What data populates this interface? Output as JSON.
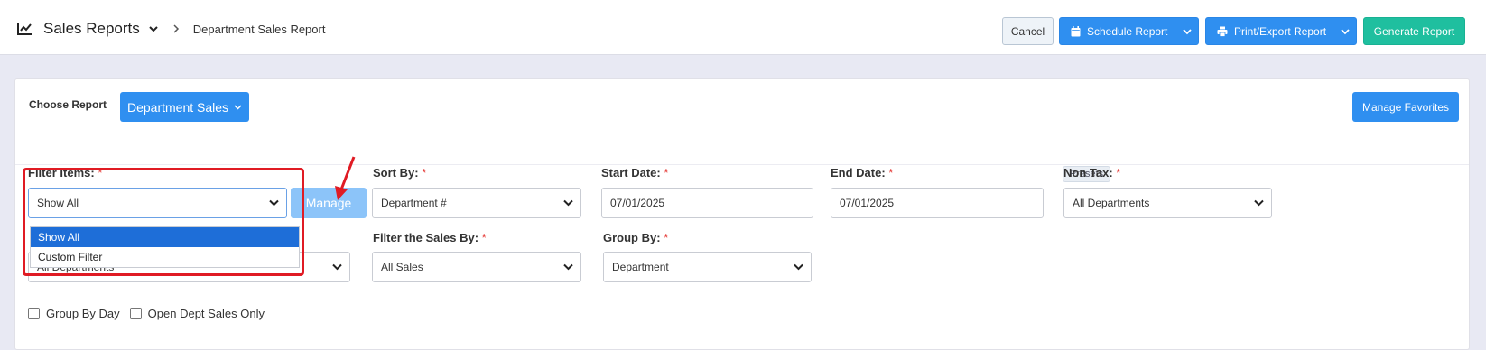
{
  "header": {
    "app_title": "Sales Reports",
    "page_title": "Department Sales Report",
    "buttons": {
      "cancel": "Cancel",
      "schedule": "Schedule Report",
      "print": "Print/Export Report",
      "generate": "Generate Report"
    }
  },
  "report": {
    "choose_label": "Choose Report",
    "selected": "Department Sales",
    "favorites": "Manage Favorites"
  },
  "filters": {
    "filter_items": {
      "label": "Filter Items:",
      "value": "Show All",
      "options": [
        "Show All",
        "Custom Filter"
      ]
    },
    "manage": "Manage",
    "sort_by": {
      "label": "Sort By:",
      "value": "Department #"
    },
    "start_date": {
      "label": "Start Date:",
      "value": "07/01/2025"
    },
    "end_date": {
      "label": "End Date:",
      "value": "07/01/2025"
    },
    "presets": "Presets",
    "non_tax": {
      "label": "Non Tax:",
      "value": "All Departments"
    },
    "departments": {
      "value": "All Departments"
    },
    "filter_sales_by": {
      "label": "Filter the Sales By:",
      "value": "All Sales"
    },
    "group_by": {
      "label": "Group By:",
      "value": "Department"
    },
    "required_mark": "*"
  },
  "checkboxes": {
    "group_by_day": "Group By Day",
    "open_dept_only": "Open Dept Sales Only"
  },
  "colors": {
    "primary": "#2f8ff0",
    "success": "#1fbf9f",
    "highlight": "#e01b24"
  }
}
